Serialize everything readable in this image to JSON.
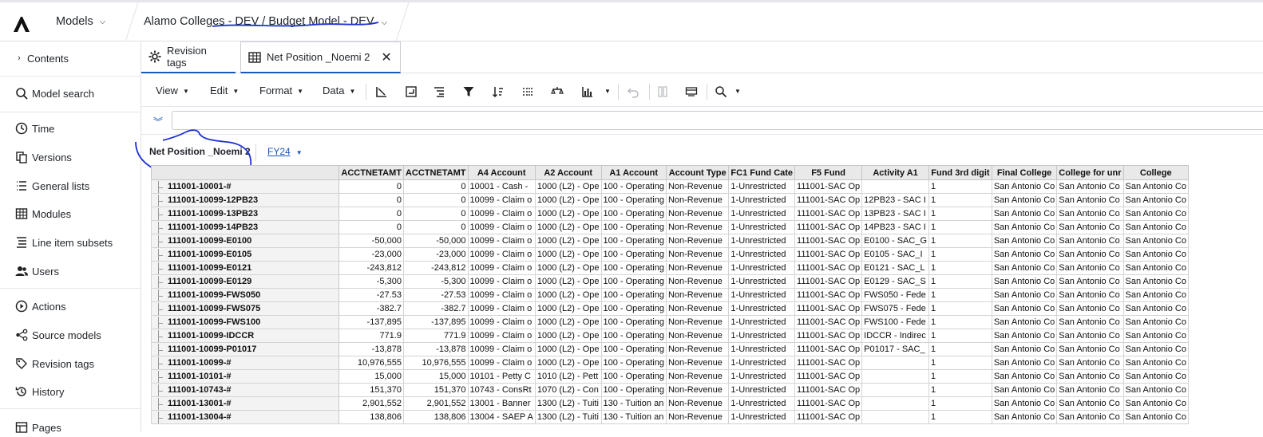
{
  "topbar": {
    "models_label": "Models",
    "breadcrumb": "Alamo Colleges - DEV / Budget Model - DEV"
  },
  "sidebar": {
    "items": [
      {
        "label": "Contents",
        "icon": "chevron-right-icon"
      },
      {
        "label": "Model search",
        "icon": "search-icon"
      },
      {
        "label": "Time",
        "icon": "clock-icon"
      },
      {
        "label": "Versions",
        "icon": "versions-icon"
      },
      {
        "label": "General lists",
        "icon": "list-icon"
      },
      {
        "label": "Modules",
        "icon": "grid-icon"
      },
      {
        "label": "Line item subsets",
        "icon": "subset-list-icon"
      },
      {
        "label": "Users",
        "icon": "users-icon"
      },
      {
        "label": "Actions",
        "icon": "play-circle-icon"
      },
      {
        "label": "Source models",
        "icon": "network-icon"
      },
      {
        "label": "Revision tags",
        "icon": "tag-icon"
      },
      {
        "label": "History",
        "icon": "history-icon"
      },
      {
        "label": "Pages",
        "icon": "pages-icon"
      }
    ]
  },
  "tabs": [
    {
      "label": "Revision tags",
      "icon": "gear-icon"
    },
    {
      "label": "Net Position _Noemi 2",
      "icon": "table-icon"
    }
  ],
  "toolbar": {
    "menus": [
      "View",
      "Edit",
      "Format",
      "Data"
    ]
  },
  "view": {
    "title": "Net Position _Noemi 2",
    "page_selector": "FY24"
  },
  "grid": {
    "columns": [
      "ACCTNETAMT",
      "ACCTNETAMT",
      "A4 Account",
      "A2 Account",
      "A1 Account",
      "Account Type",
      "FC1 Fund Cate",
      "F5 Fund",
      "Activity A1",
      "Fund 3rd digit",
      "Final College",
      "College for unr",
      "College"
    ],
    "rows": [
      {
        "label": "111001-10001-#",
        "cells": [
          "0",
          "0",
          "10001 - Cash - ",
          "1000 (L2) - Ope",
          "100 - Operating",
          "Non-Revenue",
          "1-Unrestricted",
          "111001-SAC Op",
          "",
          "1",
          "San Antonio Co",
          "San Antonio Co",
          "San Antonio Co"
        ]
      },
      {
        "label": "111001-10099-12PB23",
        "cells": [
          "0",
          "0",
          "10099 - Claim o",
          "1000 (L2) - Ope",
          "100 - Operating",
          "Non-Revenue",
          "1-Unrestricted",
          "111001-SAC Op",
          "12PB23 - SAC I",
          "1",
          "San Antonio Co",
          "San Antonio Co",
          "San Antonio Co"
        ]
      },
      {
        "label": "111001-10099-13PB23",
        "cells": [
          "0",
          "0",
          "10099 - Claim o",
          "1000 (L2) - Ope",
          "100 - Operating",
          "Non-Revenue",
          "1-Unrestricted",
          "111001-SAC Op",
          "13PB23 - SAC I",
          "1",
          "San Antonio Co",
          "San Antonio Co",
          "San Antonio Co"
        ]
      },
      {
        "label": "111001-10099-14PB23",
        "cells": [
          "0",
          "0",
          "10099 - Claim o",
          "1000 (L2) - Ope",
          "100 - Operating",
          "Non-Revenue",
          "1-Unrestricted",
          "111001-SAC Op",
          "14PB23 - SAC I",
          "1",
          "San Antonio Co",
          "San Antonio Co",
          "San Antonio Co"
        ]
      },
      {
        "label": "111001-10099-E0100",
        "cells": [
          "-50,000",
          "-50,000",
          "10099 - Claim o",
          "1000 (L2) - Ope",
          "100 - Operating",
          "Non-Revenue",
          "1-Unrestricted",
          "111001-SAC Op",
          "E0100 - SAC_G",
          "1",
          "San Antonio Co",
          "San Antonio Co",
          "San Antonio Co"
        ]
      },
      {
        "label": "111001-10099-E0105",
        "cells": [
          "-23,000",
          "-23,000",
          "10099 - Claim o",
          "1000 (L2) - Ope",
          "100 - Operating",
          "Non-Revenue",
          "1-Unrestricted",
          "111001-SAC Op",
          "E0105 - SAC_I",
          "1",
          "San Antonio Co",
          "San Antonio Co",
          "San Antonio Co"
        ]
      },
      {
        "label": "111001-10099-E0121",
        "cells": [
          "-243,812",
          "-243,812",
          "10099 - Claim o",
          "1000 (L2) - Ope",
          "100 - Operating",
          "Non-Revenue",
          "1-Unrestricted",
          "111001-SAC Op",
          "E0121 - SAC_L",
          "1",
          "San Antonio Co",
          "San Antonio Co",
          "San Antonio Co"
        ]
      },
      {
        "label": "111001-10099-E0129",
        "cells": [
          "-5,300",
          "-5,300",
          "10099 - Claim o",
          "1000 (L2) - Ope",
          "100 - Operating",
          "Non-Revenue",
          "1-Unrestricted",
          "111001-SAC Op",
          "E0129 - SAC_S",
          "1",
          "San Antonio Co",
          "San Antonio Co",
          "San Antonio Co"
        ]
      },
      {
        "label": "111001-10099-FWS050",
        "cells": [
          "-27.53",
          "-27.53",
          "10099 - Claim o",
          "1000 (L2) - Ope",
          "100 - Operating",
          "Non-Revenue",
          "1-Unrestricted",
          "111001-SAC Op",
          "FWS050 - Fede",
          "1",
          "San Antonio Co",
          "San Antonio Co",
          "San Antonio Co"
        ]
      },
      {
        "label": "111001-10099-FWS075",
        "cells": [
          "-382.7",
          "-382.7",
          "10099 - Claim o",
          "1000 (L2) - Ope",
          "100 - Operating",
          "Non-Revenue",
          "1-Unrestricted",
          "111001-SAC Op",
          "FWS075 - Fede",
          "1",
          "San Antonio Co",
          "San Antonio Co",
          "San Antonio Co"
        ]
      },
      {
        "label": "111001-10099-FWS100",
        "cells": [
          "-137,895",
          "-137,895",
          "10099 - Claim o",
          "1000 (L2) - Ope",
          "100 - Operating",
          "Non-Revenue",
          "1-Unrestricted",
          "111001-SAC Op",
          "FWS100 - Fede",
          "1",
          "San Antonio Co",
          "San Antonio Co",
          "San Antonio Co"
        ]
      },
      {
        "label": "111001-10099-IDCCR",
        "cells": [
          "771.9",
          "771.9",
          "10099 - Claim o",
          "1000 (L2) - Ope",
          "100 - Operating",
          "Non-Revenue",
          "1-Unrestricted",
          "111001-SAC Op",
          "IDCCR - Indirec",
          "1",
          "San Antonio Co",
          "San Antonio Co",
          "San Antonio Co"
        ]
      },
      {
        "label": "111001-10099-P01017",
        "cells": [
          "-13,878",
          "-13,878",
          "10099 - Claim o",
          "1000 (L2) - Ope",
          "100 - Operating",
          "Non-Revenue",
          "1-Unrestricted",
          "111001-SAC Op",
          "P01017 - SAC_",
          "1",
          "San Antonio Co",
          "San Antonio Co",
          "San Antonio Co"
        ]
      },
      {
        "label": "111001-10099-#",
        "cells": [
          "10,976,555",
          "10,976,555",
          "10099 - Claim o",
          "1000 (L2) - Ope",
          "100 - Operating",
          "Non-Revenue",
          "1-Unrestricted",
          "111001-SAC Op",
          "",
          "1",
          "San Antonio Co",
          "San Antonio Co",
          "San Antonio Co"
        ]
      },
      {
        "label": "111001-10101-#",
        "cells": [
          "15,000",
          "15,000",
          "10101 - Petty C",
          "1010 (L2) - Pett",
          "100 - Operating",
          "Non-Revenue",
          "1-Unrestricted",
          "111001-SAC Op",
          "",
          "1",
          "San Antonio Co",
          "San Antonio Co",
          "San Antonio Co"
        ]
      },
      {
        "label": "111001-10743-#",
        "cells": [
          "151,370",
          "151,370",
          "10743 - ConsRt",
          "1070 (L2) - Con",
          "100 - Operating",
          "Non-Revenue",
          "1-Unrestricted",
          "111001-SAC Op",
          "",
          "1",
          "San Antonio Co",
          "San Antonio Co",
          "San Antonio Co"
        ]
      },
      {
        "label": "111001-13001-#",
        "cells": [
          "2,901,552",
          "2,901,552",
          "13001 - Banner",
          "1300 (L2) - Tuiti",
          "130 - Tuition an",
          "Non-Revenue",
          "1-Unrestricted",
          "111001-SAC Op",
          "",
          "1",
          "San Antonio Co",
          "San Antonio Co",
          "San Antonio Co"
        ]
      },
      {
        "label": "111001-13004-#",
        "cells": [
          "138,806",
          "138,806",
          "13004 - SAEP A",
          "1300 (L2) - Tuiti",
          "130 - Tuition an",
          "Non-Revenue",
          "1-Unrestricted",
          "111001-SAC Op",
          "",
          "1",
          "San Antonio Co",
          "San Antonio Co",
          "San Antonio Co"
        ]
      }
    ]
  },
  "colors": {
    "accent": "#1a56b8",
    "annotation_ink": "#1d2fd6",
    "grid_header_bg": "#e9e9e9",
    "row_header_bg": "#f3f3f3"
  }
}
